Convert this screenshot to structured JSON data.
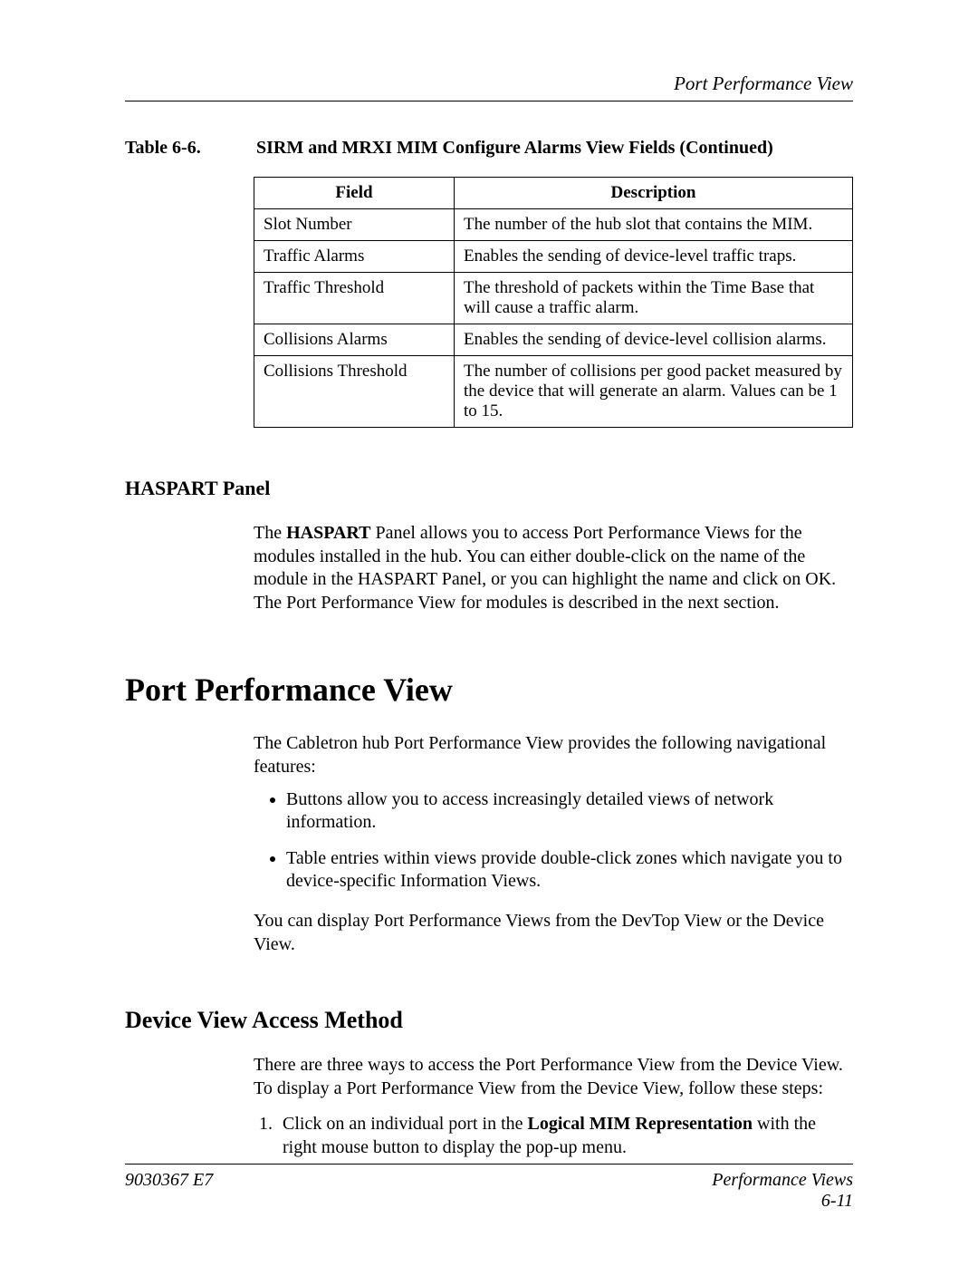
{
  "running_head": "Port Performance View",
  "table_label": {
    "number": "Table 6-6.",
    "title": "SIRM and MRXI MIM Configure Alarms View Fields  (Continued)"
  },
  "table": {
    "headers": {
      "field": "Field",
      "description": "Description"
    },
    "rows": [
      {
        "field": "Slot Number",
        "description": "The number of the hub slot that contains the MIM."
      },
      {
        "field": "Traffic Alarms",
        "description": "Enables the sending of device-level traffic traps."
      },
      {
        "field": "Traffic Threshold",
        "description": "The threshold of packets within the Time Base that will cause a traffic alarm."
      },
      {
        "field": "Collisions Alarms",
        "description": "Enables the sending of device-level collision alarms."
      },
      {
        "field": "Collisions Threshold",
        "description": "The number of collisions per good packet measured by the device that will generate an alarm. Values can be 1 to 15."
      }
    ]
  },
  "haspart": {
    "heading": "HASPART Panel",
    "body_prefix": "The ",
    "body_bold": "HASPART",
    "body_suffix": " Panel allows you to access Port Performance Views for the modules installed in the hub. You can either double-click on the name of the module in the HASPART Panel, or you can highlight the name and click on OK. The Port Performance View for modules is described in the next section."
  },
  "section": {
    "title": "Port Performance View",
    "intro": "The Cabletron hub Port Performance View provides the following navigational features:",
    "bullets": [
      "Buttons allow you to access increasingly detailed views of network information.",
      "Table entries within views provide double-click zones which navigate you to device-specific Information Views."
    ],
    "outro": "You can display Port Performance Views from the DevTop View or the Device View."
  },
  "access": {
    "heading": "Device View Access Method",
    "intro": "There are three ways to access the Port Performance View from the Device View. To display a Port Performance View from the Device View, follow these steps:",
    "step1_prefix": "Click on an individual port in the ",
    "step1_bold": "Logical MIM Representation",
    "step1_suffix": " with the right mouse button to display the pop-up menu."
  },
  "footer": {
    "left": "9030367 E7",
    "right_top": "Performance Views",
    "right_bottom": "6-11"
  }
}
